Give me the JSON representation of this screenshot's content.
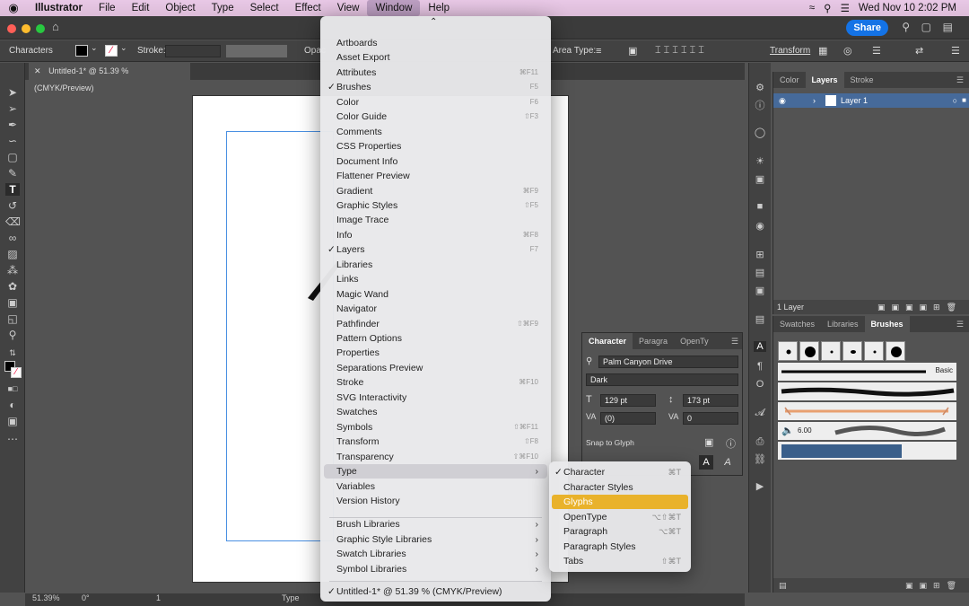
{
  "menubar": {
    "apple": "",
    "app": "Illustrator",
    "items": [
      "File",
      "Edit",
      "Object",
      "Type",
      "Select",
      "Effect",
      "View",
      "Window",
      "Help"
    ],
    "clock": "Wed Nov 10  2:02 PM"
  },
  "header": {
    "share_label": "Share"
  },
  "control_bar": {
    "selection_label": "Characters",
    "stroke_label": "Stroke:",
    "opacity_label": "Opac",
    "area_type_label": "Area Type:",
    "transform_label": "Transform"
  },
  "document_tab": {
    "title": "Untitled-1* @ 51.39 % (CMYK/Preview)"
  },
  "status_bar": {
    "zoom": "51.39%",
    "rotation": "0°",
    "artboard": "1",
    "tool": "Type"
  },
  "layers_panel": {
    "tabs": [
      "Color",
      "Layers",
      "Stroke"
    ],
    "active_tab": "Layers",
    "layer_name": "Layer 1",
    "footer": "1 Layer"
  },
  "brushes_panel": {
    "tabs": [
      "Swatches",
      "Libraries",
      "Brushes"
    ],
    "active_tab": "Brushes",
    "basic_label": "Basic",
    "size_value": "6.00"
  },
  "character_panel": {
    "tabs": [
      "Character",
      "Paragra",
      "OpenTy"
    ],
    "font_family": "Palm Canyon Drive",
    "font_style": "Dark",
    "font_size": "129 pt",
    "leading": "173 pt",
    "kerning": "(0)",
    "tracking": "0",
    "snap_label": "Snap to Glyph"
  },
  "window_menu": {
    "items": [
      {
        "label": "Artboards",
        "shortcut": "",
        "checked": false
      },
      {
        "label": "Asset Export",
        "shortcut": "",
        "checked": false
      },
      {
        "label": "Attributes",
        "shortcut": "⌘F11",
        "checked": false
      },
      {
        "label": "Brushes",
        "shortcut": "F5",
        "checked": true
      },
      {
        "label": "Color",
        "shortcut": "F6",
        "checked": false
      },
      {
        "label": "Color Guide",
        "shortcut": "⇧F3",
        "checked": false
      },
      {
        "label": "Comments",
        "shortcut": "",
        "checked": false
      },
      {
        "label": "CSS Properties",
        "shortcut": "",
        "checked": false
      },
      {
        "label": "Document Info",
        "shortcut": "",
        "checked": false
      },
      {
        "label": "Flattener Preview",
        "shortcut": "",
        "checked": false
      },
      {
        "label": "Gradient",
        "shortcut": "⌘F9",
        "checked": false
      },
      {
        "label": "Graphic Styles",
        "shortcut": "⇧F5",
        "checked": false
      },
      {
        "label": "Image Trace",
        "shortcut": "",
        "checked": false
      },
      {
        "label": "Info",
        "shortcut": "⌘F8",
        "checked": false
      },
      {
        "label": "Layers",
        "shortcut": "F7",
        "checked": true
      },
      {
        "label": "Libraries",
        "shortcut": "",
        "checked": false
      },
      {
        "label": "Links",
        "shortcut": "",
        "checked": false
      },
      {
        "label": "Magic Wand",
        "shortcut": "",
        "checked": false
      },
      {
        "label": "Navigator",
        "shortcut": "",
        "checked": false
      },
      {
        "label": "Pathfinder",
        "shortcut": "⇧⌘F9",
        "checked": false
      },
      {
        "label": "Pattern Options",
        "shortcut": "",
        "checked": false
      },
      {
        "label": "Properties",
        "shortcut": "",
        "checked": false
      },
      {
        "label": "Separations Preview",
        "shortcut": "",
        "checked": false
      },
      {
        "label": "Stroke",
        "shortcut": "⌘F10",
        "checked": false
      },
      {
        "label": "SVG Interactivity",
        "shortcut": "",
        "checked": false
      },
      {
        "label": "Swatches",
        "shortcut": "",
        "checked": false
      },
      {
        "label": "Symbols",
        "shortcut": "⇧⌘F11",
        "checked": false
      },
      {
        "label": "Transform",
        "shortcut": "⇧F8",
        "checked": false
      },
      {
        "label": "Transparency",
        "shortcut": "⇧⌘F10",
        "checked": false
      },
      {
        "label": "Type",
        "shortcut": "",
        "checked": false,
        "submenu": true
      },
      {
        "label": "Variables",
        "shortcut": "",
        "checked": false
      },
      {
        "label": "Version History",
        "shortcut": "",
        "checked": false
      }
    ],
    "libraries": [
      "Brush Libraries",
      "Graphic Style Libraries",
      "Swatch Libraries",
      "Symbol Libraries"
    ],
    "open_document": "Untitled-1* @ 51.39 % (CMYK/Preview)"
  },
  "type_submenu": {
    "items": [
      {
        "label": "Character",
        "shortcut": "⌘T",
        "checked": true
      },
      {
        "label": "Character Styles",
        "shortcut": "",
        "checked": false
      },
      {
        "label": "Glyphs",
        "shortcut": "",
        "checked": false,
        "highlighted": true
      },
      {
        "label": "OpenType",
        "shortcut": "⌥⇧⌘T",
        "checked": false
      },
      {
        "label": "Paragraph",
        "shortcut": "⌥⌘T",
        "checked": false
      },
      {
        "label": "Paragraph Styles",
        "shortcut": "",
        "checked": false
      },
      {
        "label": "Tabs",
        "shortcut": "⇧⌘T",
        "checked": false
      }
    ]
  },
  "colors": {
    "highlight": "#e9b22b",
    "share": "#1473e6",
    "layer_row": "#466a9a"
  }
}
